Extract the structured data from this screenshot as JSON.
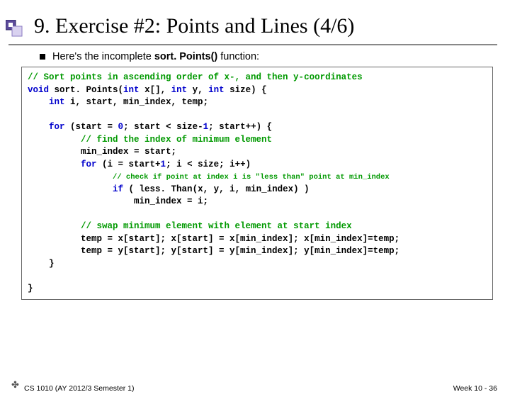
{
  "title": "9. Exercise #2: Points and Lines (4/6)",
  "intro": {
    "prefix": "Here's the incomplete ",
    "bold": "sort. Points()",
    "suffix": " function:"
  },
  "code": {
    "l1": "// Sort points in ascending order of x-, and then y-coordinates",
    "l2a": "void",
    "l2b": " sort. Points(",
    "l2c": "int",
    "l2d": " x[], ",
    "l2e": "int",
    "l2f": " y, ",
    "l2g": "int",
    "l2h": " size) {",
    "l3a": "int",
    "l3b": " i, start, min_index, temp;",
    "l4a": "for",
    "l4b": " (start = ",
    "l4c": "0",
    "l4d": "; start < size-",
    "l4e": "1",
    "l4f": "; start++) {",
    "l5": "// find the index of minimum element",
    "l6": "min_index = start;",
    "l7a": "for",
    "l7b": " (i = start+",
    "l7c": "1",
    "l7d": "; i < size; i++)",
    "l8": "// check if point at index i is \"less than\" point at min_index",
    "l9a": "if",
    "l9b": " ( less. Than(x, y, i, min_index) )",
    "l10": "min_index = i;",
    "l11": "// swap minimum element with element at start index",
    "l12": "temp = x[start]; x[start] = x[min_index]; x[min_index]=temp;",
    "l13": "temp = y[start]; y[start] = y[min_index]; y[min_index]=temp;",
    "l14": "}",
    "l15": "}"
  },
  "footer": {
    "left": "CS 1010 (AY 2012/3 Semester 1)",
    "right": "Week 10 - 36"
  }
}
